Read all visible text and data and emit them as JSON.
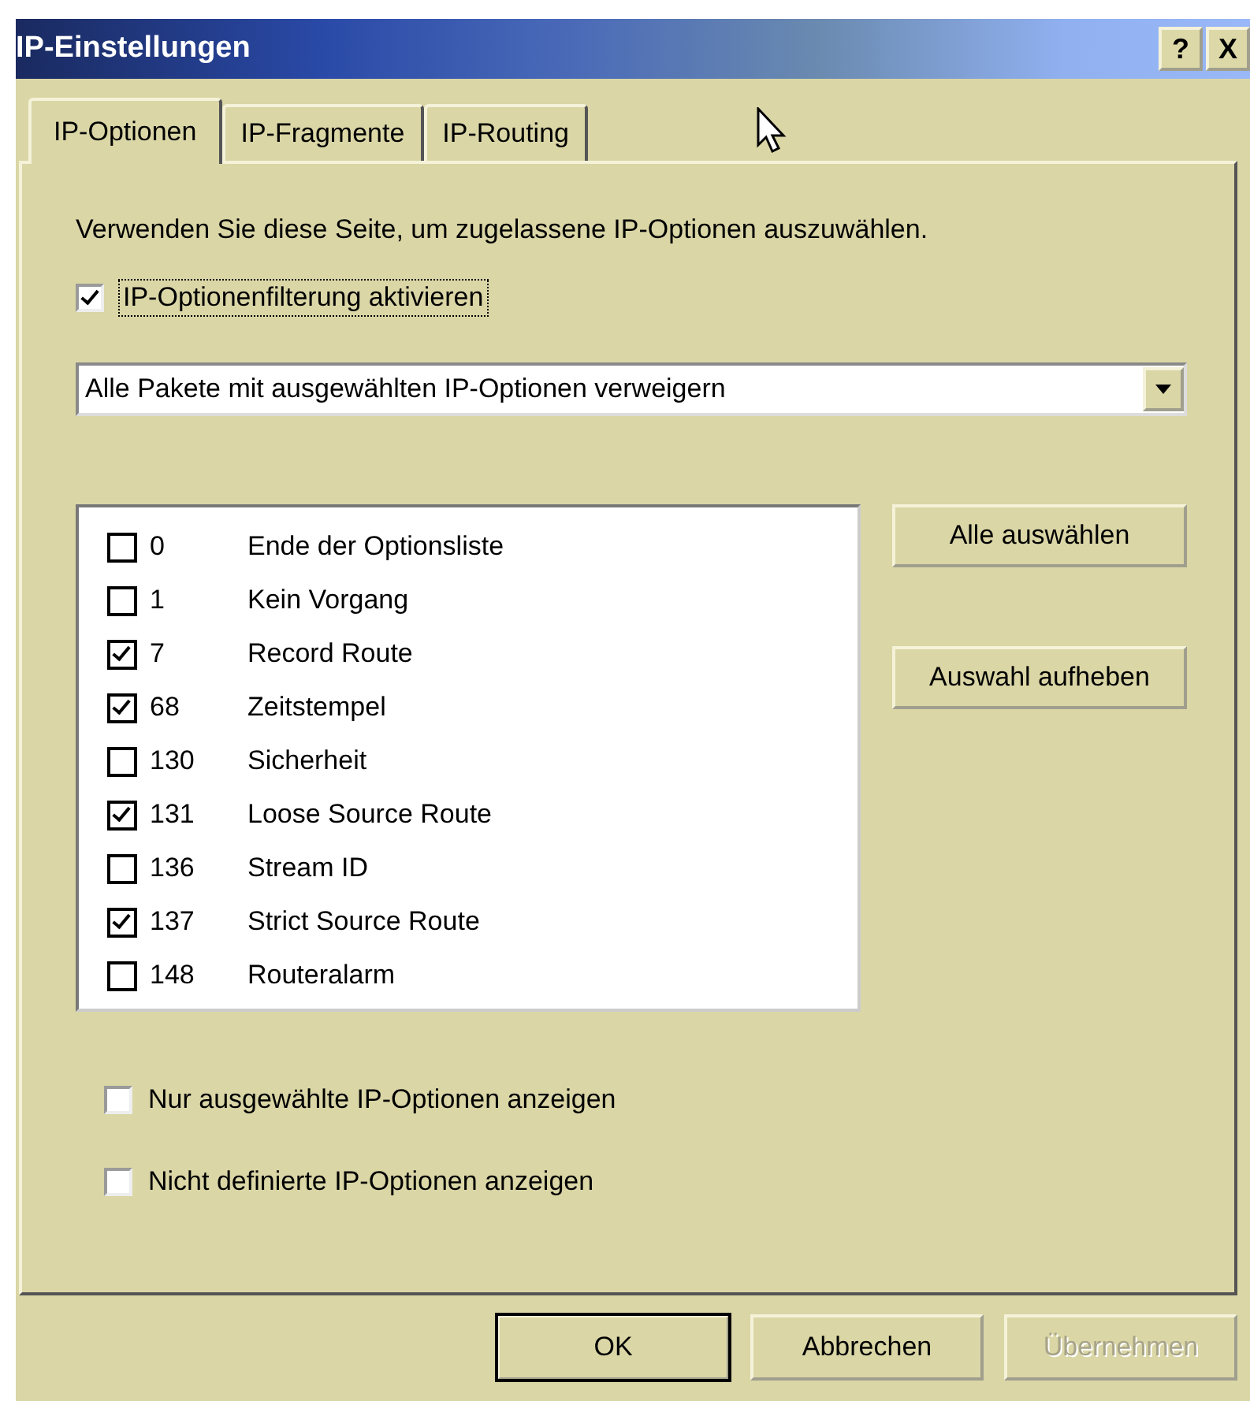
{
  "window": {
    "title": "IP-Einstellungen",
    "help_button": "?",
    "close_button": "X"
  },
  "tabs": [
    {
      "label": "IP-Optionen",
      "selected": true
    },
    {
      "label": "IP-Fragmente",
      "selected": false
    },
    {
      "label": "IP-Routing",
      "selected": false
    }
  ],
  "description": "Verwenden Sie diese Seite, um zugelassene IP-Optionen auszuwählen.",
  "filter_checkbox": {
    "label": "IP-Optionenfilterung aktivieren",
    "checked": true
  },
  "dropdown": {
    "value": "Alle Pakete mit ausgewählten IP-Optionen verweigern"
  },
  "options": [
    {
      "code": "0",
      "name": "Ende der Optionsliste",
      "checked": false
    },
    {
      "code": "1",
      "name": "Kein Vorgang",
      "checked": false
    },
    {
      "code": "7",
      "name": "Record Route",
      "checked": true
    },
    {
      "code": "68",
      "name": "Zeitstempel",
      "checked": true
    },
    {
      "code": "130",
      "name": "Sicherheit",
      "checked": false
    },
    {
      "code": "131",
      "name": "Loose Source Route",
      "checked": true
    },
    {
      "code": "136",
      "name": "Stream ID",
      "checked": false
    },
    {
      "code": "137",
      "name": "Strict Source Route",
      "checked": true
    },
    {
      "code": "148",
      "name": "Routeralarm",
      "checked": false
    }
  ],
  "side_buttons": [
    "Alle auswählen",
    "Auswahl aufheben"
  ],
  "bottom_checkboxes": [
    {
      "label": "Nur ausgewählte IP-Optionen anzeigen",
      "checked": false
    },
    {
      "label": "Nicht definierte IP-Optionen anzeigen",
      "checked": false
    }
  ],
  "buttons": [
    {
      "label": "OK",
      "disabled": false
    },
    {
      "label": "Abbrechen",
      "disabled": false
    },
    {
      "label": "Übernehmen",
      "disabled": true
    }
  ]
}
